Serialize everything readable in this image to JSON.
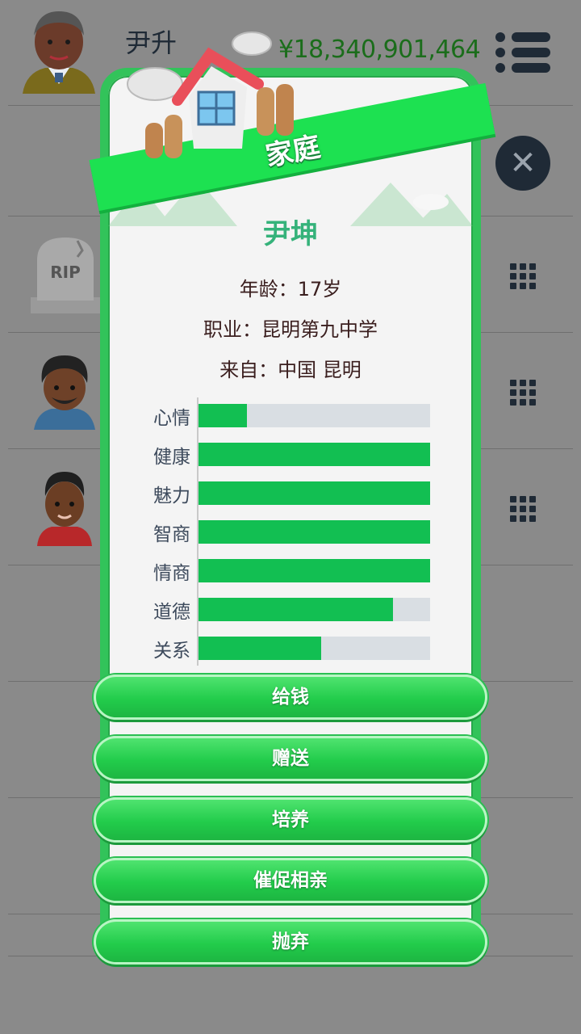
{
  "header": {
    "player_name": "尹升",
    "money": "¥18,340,901,464"
  },
  "modal": {
    "title": "家庭",
    "person": {
      "name": "尹坤",
      "age_line": "年龄：17岁",
      "job_line": "职业：昆明第九中学",
      "from_line": "来自：中国 昆明"
    },
    "stats": [
      {
        "label": "心情",
        "value": 0.21
      },
      {
        "label": "健康",
        "value": 1.0
      },
      {
        "label": "魅力",
        "value": 1.0
      },
      {
        "label": "智商",
        "value": 1.0
      },
      {
        "label": "情商",
        "value": 1.0
      },
      {
        "label": "道德",
        "value": 0.84
      },
      {
        "label": "关系",
        "value": 0.53
      }
    ],
    "actions": [
      "给钱",
      "赠送",
      "培养",
      "催促相亲",
      "抛弃"
    ]
  },
  "background_list": {
    "rip_text": "RIP"
  },
  "colors": {
    "accent_green": "#1de151",
    "bar_fill": "#12bf52",
    "bar_track": "#d9dee3",
    "name_color": "#35b27a"
  },
  "icons": [
    "menu-icon",
    "close-icon",
    "grid-icon",
    "house-icon",
    "gravestone-icon"
  ]
}
